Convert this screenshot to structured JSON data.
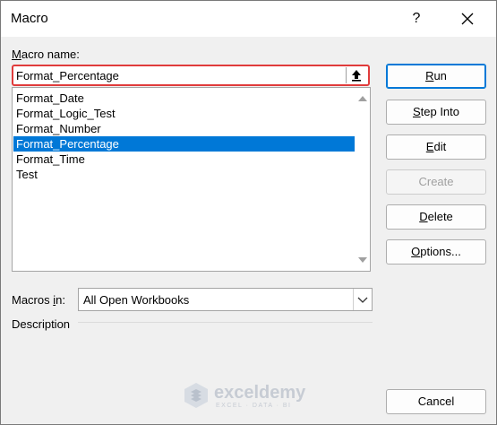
{
  "window": {
    "title": "Macro",
    "help_label": "?"
  },
  "macro_name": {
    "label_accel": "M",
    "label_rest": "acro name:",
    "value": "Format_Percentage"
  },
  "macro_list": {
    "items": [
      "Format_Date",
      "Format_Logic_Test",
      "Format_Number",
      "Format_Percentage",
      "Format_Time",
      "Test"
    ],
    "selected_index": 3
  },
  "buttons": {
    "run": {
      "accel": "R",
      "rest": "un"
    },
    "step": {
      "accel": "S",
      "rest": "tep Into"
    },
    "edit": {
      "accel": "E",
      "rest": "dit"
    },
    "create": {
      "label": "Create"
    },
    "delete": {
      "accel": "D",
      "rest": "elete"
    },
    "options": {
      "accel": "O",
      "rest": "ptions..."
    },
    "cancel": {
      "label": "Cancel"
    }
  },
  "macros_in": {
    "label_pre": "Macros ",
    "label_accel": "i",
    "label_post": "n:",
    "value": "All Open Workbooks"
  },
  "description": {
    "label": "Description"
  },
  "watermark": {
    "name": "exceldemy",
    "tagline": "EXCEL · DATA · BI"
  },
  "colors": {
    "selection": "#0078d7",
    "highlight_border": "#e03b3b",
    "primary_border": "#0078d7"
  }
}
